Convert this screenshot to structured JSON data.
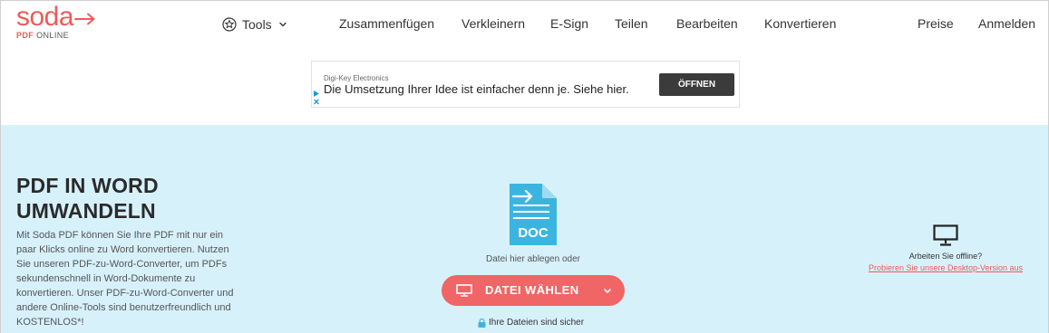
{
  "brand": {
    "name": "soda",
    "sub_bold": "PDF",
    "sub_light": "ONLINE",
    "color": "#ef5a5a"
  },
  "header": {
    "tools_label": "Tools",
    "tools_icon": "star-circle-icon",
    "nav": [
      "Zusammenfügen",
      "Verkleinern",
      "E-Sign",
      "Teilen",
      "Bearbeiten",
      "Konvertieren"
    ],
    "pricing": "Preise",
    "login": "Anmelden"
  },
  "ad": {
    "advertiser": "Digi-Key Electronics",
    "headline": "Die Umsetzung Ihrer Idee ist einfacher denn je. Siehe hier.",
    "cta": "ÖFFNEN"
  },
  "hero": {
    "background": "#d7f1fb",
    "title_line1": "PDF IN WORD",
    "title_line2": "UMWANDELN",
    "description": "Mit Soda PDF können Sie Ihre PDF mit nur ein paar Klicks online zu Word konvertieren. Nutzen Sie unseren PDF-zu-Word-Converter, um PDFs sekundenschnell in Word-Dokumente zu konvertieren. Unser PDF-zu-Word-Converter und andere Online-Tools sind benutzerfreundlich und KOSTENLOS*!",
    "doc_icon_label": "DOC",
    "drop_text": "Datei hier ablegen oder",
    "choose_button": "DATEI WÄHLEN",
    "choose_color": "#f06566",
    "secure_text": "Ihre Dateien sind sicher",
    "offline_question": "Arbeiten Sie offline?",
    "offline_link": "Probieren Sie unsere Desktop-Version aus"
  }
}
